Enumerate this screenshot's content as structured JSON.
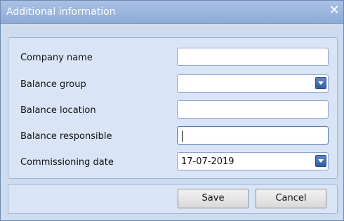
{
  "dialog": {
    "title": "Additional information",
    "close_icon": "close-icon"
  },
  "form": {
    "company_name": {
      "label": "Company name",
      "value": ""
    },
    "balance_group": {
      "label": "Balance group",
      "value": ""
    },
    "balance_location": {
      "label": "Balance location",
      "value": ""
    },
    "balance_responsible": {
      "label": "Balance responsible",
      "value": ""
    },
    "commissioning_date": {
      "label": "Commissioning date",
      "value": "17-07-2019"
    }
  },
  "buttons": {
    "save_label": "Save",
    "cancel_label": "Cancel"
  },
  "colors": {
    "titlebar": "#9bb6df",
    "panel": "#d9e5f7",
    "dropdown_button": "#2f5ea5"
  }
}
